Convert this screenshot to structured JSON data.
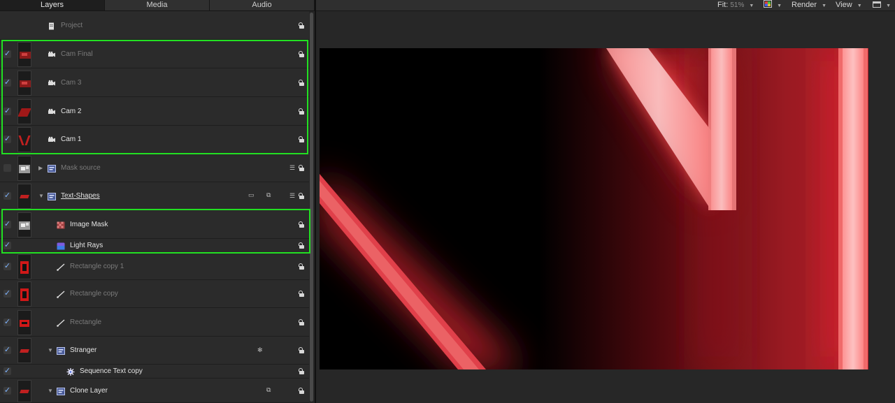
{
  "tabs": [
    "Layers",
    "Media",
    "Audio"
  ],
  "toolbar": {
    "fit_label": "Fit:",
    "fit_value": "51%",
    "render_label": "Render",
    "view_label": "View"
  },
  "layers": [
    {
      "name": "Project",
      "checked": null,
      "thumb": "none",
      "icon": "project",
      "style": "dim",
      "indent": 1,
      "expand": "",
      "extra": ""
    },
    {
      "name": "Cam Final",
      "checked": true,
      "thumb": "cam",
      "icon": "camera",
      "style": "dim",
      "indent": 1,
      "expand": "",
      "extra": ""
    },
    {
      "name": "Cam 3",
      "checked": true,
      "thumb": "cam",
      "icon": "camera",
      "style": "dim",
      "indent": 1,
      "expand": "",
      "extra": ""
    },
    {
      "name": "Cam 2",
      "checked": true,
      "thumb": "cam2",
      "icon": "camera",
      "style": "bold",
      "indent": 1,
      "expand": "",
      "extra": ""
    },
    {
      "name": "Cam 1",
      "checked": true,
      "thumb": "cam1",
      "icon": "camera",
      "style": "bold",
      "indent": 1,
      "expand": "",
      "extra": ""
    },
    {
      "name": "Mask source",
      "checked": false,
      "thumb": "mask",
      "icon": "group",
      "style": "dim",
      "indent": 1,
      "expand": "▶",
      "extra": "stack"
    },
    {
      "name": "Text-Shapes",
      "checked": true,
      "thumb": "text",
      "icon": "group",
      "style": "bold",
      "indent": 1,
      "expand": "▼",
      "extra": "shapes"
    },
    {
      "name": "Image Mask",
      "checked": true,
      "thumb": "mask",
      "icon": "imagemask",
      "style": "bold",
      "indent": 2,
      "expand": "",
      "extra": ""
    },
    {
      "name": "Light Rays",
      "checked": true,
      "thumb": "none",
      "icon": "filter",
      "style": "bold",
      "indent": 2,
      "expand": "",
      "extra": ""
    },
    {
      "name": "Rectangle copy 1",
      "checked": true,
      "thumb": "rect1",
      "icon": "shape",
      "style": "dim",
      "indent": 2,
      "expand": "",
      "extra": ""
    },
    {
      "name": "Rectangle copy",
      "checked": true,
      "thumb": "rect1",
      "icon": "shape",
      "style": "dim",
      "indent": 2,
      "expand": "",
      "extra": ""
    },
    {
      "name": "Rectangle",
      "checked": true,
      "thumb": "rect2",
      "icon": "shape",
      "style": "dim",
      "indent": 2,
      "expand": "",
      "extra": ""
    },
    {
      "name": "Stranger",
      "checked": true,
      "thumb": "text",
      "icon": "group",
      "style": "bold",
      "indent": 2,
      "expand": "▼",
      "extra": "gear"
    },
    {
      "name": "Sequence Text copy",
      "checked": true,
      "thumb": "none",
      "icon": "behavior",
      "style": "bold",
      "indent": 3,
      "expand": "",
      "extra": ""
    },
    {
      "name": "Clone Layer",
      "checked": true,
      "thumb": "text",
      "icon": "group",
      "style": "bold",
      "indent": 2,
      "expand": "▼",
      "extra": "clone"
    }
  ],
  "colors": {
    "accent_green": "#22e022",
    "check_blue": "#7fb5ff",
    "glow_red": "#e0303a"
  }
}
